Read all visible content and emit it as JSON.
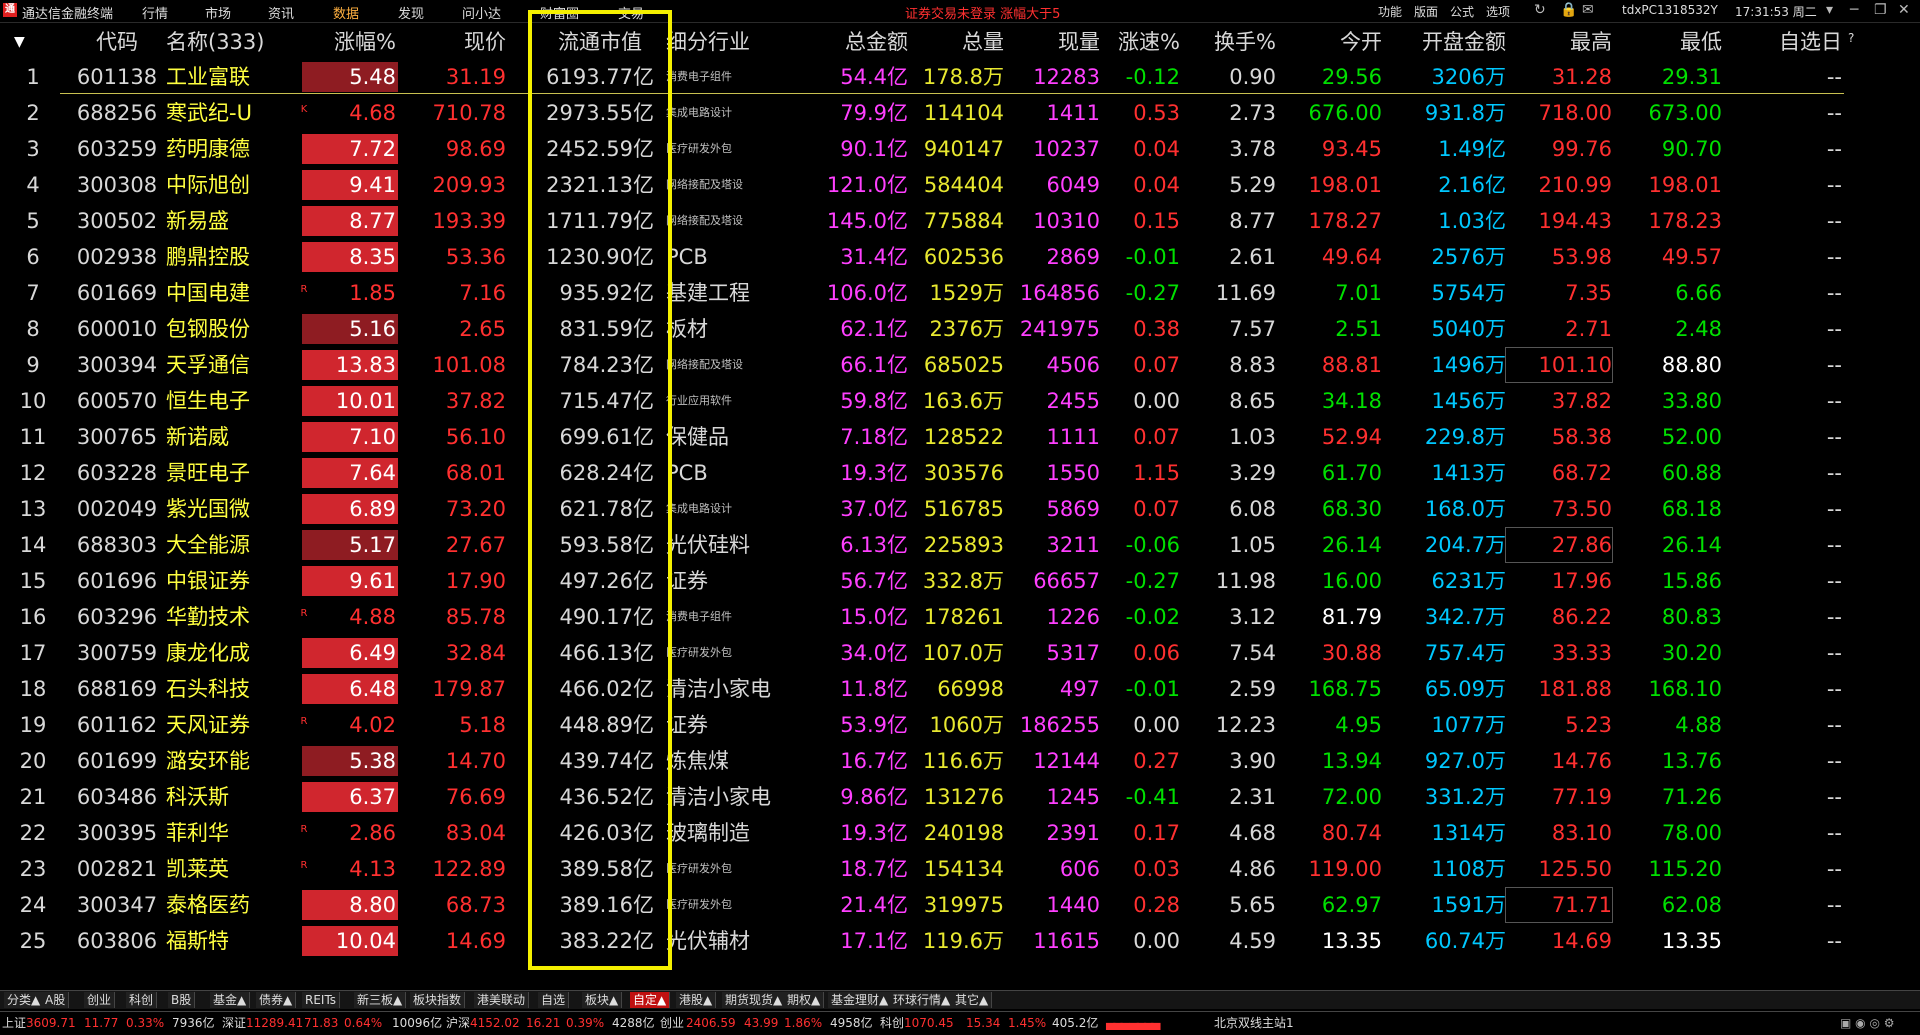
{
  "app": {
    "title": "通达信金融终端",
    "menus": [
      "行情",
      "市场",
      "资讯",
      "数据",
      "发现",
      "问小达",
      "财富圈",
      "交易"
    ],
    "active_menu": "数据",
    "notice": "证券交易未登录  涨幅大于5",
    "right_menus": [
      "功能",
      "版面",
      "公式",
      "选项"
    ],
    "user": "tdxPC1318532Y",
    "clock": "17:31:53 周二",
    "icons": [
      "refresh-icon",
      "lock-icon",
      "mail-icon",
      "minimize-icon",
      "restore-icon",
      "close-icon"
    ]
  },
  "table": {
    "sort_indicator": "▼",
    "headers": [
      "代码",
      "名称(333)",
      "涨幅%",
      "现价",
      "流通市值",
      "细分行业",
      "总金额",
      "总量",
      "现量",
      "涨速%",
      "换手%",
      "今开",
      "开盘金额",
      "最高",
      "最低",
      "自选日"
    ],
    "header_corner_mark": "?",
    "rows": [
      {
        "no": "1",
        "code": "601138",
        "name": "工业富联",
        "mark": "",
        "chg": "5.48",
        "price": "31.19",
        "mcap": "6193.77亿",
        "industry": "消费电子组件",
        "ind_small": true,
        "amount": "54.4亿",
        "vol": "178.8万",
        "lastvol": "12283",
        "speed": "-0.12",
        "turnover": "0.90",
        "open": "29.56",
        "open_amt": "3206万",
        "high": "31.28",
        "low": "29.31",
        "fav": "--"
      },
      {
        "no": "2",
        "code": "688256",
        "name": "寒武纪-U",
        "mark": "K",
        "chg": "4.68",
        "price": "710.78",
        "mcap": "2973.55亿",
        "industry": "集成电路设计",
        "ind_small": true,
        "amount": "79.9亿",
        "vol": "114104",
        "lastvol": "1411",
        "speed": "0.53",
        "turnover": "2.73",
        "open": "676.00",
        "open_amt": "931.8万",
        "high": "718.00",
        "low": "673.00",
        "fav": "--"
      },
      {
        "no": "3",
        "code": "603259",
        "name": "药明康德",
        "mark": "",
        "chg": "7.72",
        "price": "98.69",
        "mcap": "2452.59亿",
        "industry": "医疗研发外包",
        "ind_small": true,
        "amount": "90.1亿",
        "vol": "940147",
        "lastvol": "10237",
        "speed": "0.04",
        "turnover": "3.78",
        "open": "93.45",
        "open_amt": "1.49亿",
        "high": "99.76",
        "low": "90.70",
        "fav": "--"
      },
      {
        "no": "4",
        "code": "300308",
        "name": "中际旭创",
        "mark": "",
        "chg": "9.41",
        "price": "209.93",
        "mcap": "2321.13亿",
        "industry": "网络接配及塔设",
        "ind_small": true,
        "amount": "121.0亿",
        "vol": "584404",
        "lastvol": "6049",
        "speed": "0.04",
        "turnover": "5.29",
        "open": "198.01",
        "open_amt": "2.16亿",
        "high": "210.99",
        "low": "198.01",
        "fav": "--"
      },
      {
        "no": "5",
        "code": "300502",
        "name": "新易盛",
        "mark": "",
        "chg": "8.77",
        "price": "193.39",
        "mcap": "1711.79亿",
        "industry": "网络接配及塔设",
        "ind_small": true,
        "amount": "145.0亿",
        "vol": "775884",
        "lastvol": "10310",
        "speed": "0.15",
        "turnover": "8.77",
        "open": "178.27",
        "open_amt": "1.03亿",
        "high": "194.43",
        "low": "178.23",
        "fav": "--"
      },
      {
        "no": "6",
        "code": "002938",
        "name": "鹏鼎控股",
        "mark": "",
        "chg": "8.35",
        "price": "53.36",
        "mcap": "1230.90亿",
        "industry": "PCB",
        "ind_small": false,
        "amount": "31.4亿",
        "vol": "602536",
        "lastvol": "2869",
        "speed": "-0.01",
        "turnover": "2.61",
        "open": "49.64",
        "open_amt": "2576万",
        "high": "53.98",
        "low": "49.57",
        "fav": "--"
      },
      {
        "no": "7",
        "code": "601669",
        "name": "中国电建",
        "mark": "R",
        "chg": "1.85",
        "price": "7.16",
        "mcap": "935.92亿",
        "industry": "基建工程",
        "ind_small": false,
        "amount": "106.0亿",
        "vol": "1529万",
        "lastvol": "164856",
        "speed": "-0.27",
        "turnover": "11.69",
        "open": "7.01",
        "open_amt": "5754万",
        "high": "7.35",
        "low": "6.66",
        "fav": "--"
      },
      {
        "no": "8",
        "code": "600010",
        "name": "包钢股份",
        "mark": "",
        "chg": "5.16",
        "price": "2.65",
        "mcap": "831.59亿",
        "industry": "板材",
        "ind_small": false,
        "amount": "62.1亿",
        "vol": "2376万",
        "lastvol": "241975",
        "speed": "0.38",
        "turnover": "7.57",
        "open": "2.51",
        "open_amt": "5040万",
        "high": "2.71",
        "low": "2.48",
        "fav": "--"
      },
      {
        "no": "9",
        "code": "300394",
        "name": "天孚通信",
        "mark": "",
        "chg": "13.83",
        "price": "101.08",
        "mcap": "784.23亿",
        "industry": "网络接配及塔设",
        "ind_small": true,
        "amount": "66.1亿",
        "vol": "685025",
        "lastvol": "4506",
        "speed": "0.07",
        "turnover": "8.83",
        "open": "88.81",
        "open_amt": "1496万",
        "high": "101.10",
        "low": "88.80",
        "fav": "--"
      },
      {
        "no": "10",
        "code": "600570",
        "name": "恒生电子",
        "mark": "",
        "chg": "10.01",
        "price": "37.82",
        "mcap": "715.47亿",
        "industry": "行业应用软件",
        "ind_small": true,
        "amount": "59.8亿",
        "vol": "163.6万",
        "lastvol": "2455",
        "speed": "0.00",
        "turnover": "8.65",
        "open": "34.18",
        "open_amt": "1456万",
        "high": "37.82",
        "low": "33.80",
        "fav": "--"
      },
      {
        "no": "11",
        "code": "300765",
        "name": "新诺威",
        "mark": "",
        "chg": "7.10",
        "price": "56.10",
        "mcap": "699.61亿",
        "industry": "保健品",
        "ind_small": false,
        "amount": "7.18亿",
        "vol": "128522",
        "lastvol": "1111",
        "speed": "0.07",
        "turnover": "1.03",
        "open": "52.94",
        "open_amt": "229.8万",
        "high": "58.38",
        "low": "52.00",
        "fav": "--"
      },
      {
        "no": "12",
        "code": "603228",
        "name": "景旺电子",
        "mark": "",
        "chg": "7.64",
        "price": "68.01",
        "mcap": "628.24亿",
        "industry": "PCB",
        "ind_small": false,
        "amount": "19.3亿",
        "vol": "303576",
        "lastvol": "1550",
        "speed": "1.15",
        "turnover": "3.29",
        "open": "61.70",
        "open_amt": "1413万",
        "high": "68.72",
        "low": "60.88",
        "fav": "--"
      },
      {
        "no": "13",
        "code": "002049",
        "name": "紫光国微",
        "mark": "",
        "chg": "6.89",
        "price": "73.20",
        "mcap": "621.78亿",
        "industry": "集成电路设计",
        "ind_small": true,
        "amount": "37.0亿",
        "vol": "516785",
        "lastvol": "5869",
        "speed": "0.07",
        "turnover": "6.08",
        "open": "68.30",
        "open_amt": "168.0万",
        "high": "73.50",
        "low": "68.18",
        "fav": "--"
      },
      {
        "no": "14",
        "code": "688303",
        "name": "大全能源",
        "mark": "",
        "chg": "5.17",
        "price": "27.67",
        "mcap": "593.58亿",
        "industry": "光伏硅料",
        "ind_small": false,
        "amount": "6.13亿",
        "vol": "225893",
        "lastvol": "3211",
        "speed": "-0.06",
        "turnover": "1.05",
        "open": "26.14",
        "open_amt": "204.7万",
        "high": "27.86",
        "low": "26.14",
        "fav": "--"
      },
      {
        "no": "15",
        "code": "601696",
        "name": "中银证券",
        "mark": "",
        "chg": "9.61",
        "price": "17.90",
        "mcap": "497.26亿",
        "industry": "证券",
        "ind_small": false,
        "amount": "56.7亿",
        "vol": "332.8万",
        "lastvol": "66657",
        "speed": "-0.27",
        "turnover": "11.98",
        "open": "16.00",
        "open_amt": "6231万",
        "high": "17.96",
        "low": "15.86",
        "fav": "--"
      },
      {
        "no": "16",
        "code": "603296",
        "name": "华勤技术",
        "mark": "R",
        "chg": "4.88",
        "price": "85.78",
        "mcap": "490.17亿",
        "industry": "消费电子组件",
        "ind_small": true,
        "amount": "15.0亿",
        "vol": "178261",
        "lastvol": "1226",
        "speed": "-0.02",
        "turnover": "3.12",
        "open": "81.79",
        "open_amt": "342.7万",
        "high": "86.22",
        "low": "80.83",
        "fav": "--"
      },
      {
        "no": "17",
        "code": "300759",
        "name": "康龙化成",
        "mark": "",
        "chg": "6.49",
        "price": "32.84",
        "mcap": "466.13亿",
        "industry": "医疗研发外包",
        "ind_small": true,
        "amount": "34.0亿",
        "vol": "107.0万",
        "lastvol": "5317",
        "speed": "0.06",
        "turnover": "7.54",
        "open": "30.88",
        "open_amt": "757.4万",
        "high": "33.33",
        "low": "30.20",
        "fav": "--"
      },
      {
        "no": "18",
        "code": "688169",
        "name": "石头科技",
        "mark": "",
        "chg": "6.48",
        "price": "179.87",
        "mcap": "466.02亿",
        "industry": "清洁小家电",
        "ind_small": false,
        "amount": "11.8亿",
        "vol": "66998",
        "lastvol": "497",
        "speed": "-0.01",
        "turnover": "2.59",
        "open": "168.75",
        "open_amt": "65.09万",
        "high": "181.88",
        "low": "168.10",
        "fav": "--"
      },
      {
        "no": "19",
        "code": "601162",
        "name": "天风证券",
        "mark": "R",
        "chg": "4.02",
        "price": "5.18",
        "mcap": "448.89亿",
        "industry": "证券",
        "ind_small": false,
        "amount": "53.9亿",
        "vol": "1060万",
        "lastvol": "186255",
        "speed": "0.00",
        "turnover": "12.23",
        "open": "4.95",
        "open_amt": "1077万",
        "high": "5.23",
        "low": "4.88",
        "fav": "--"
      },
      {
        "no": "20",
        "code": "601699",
        "name": "潞安环能",
        "mark": "",
        "chg": "5.38",
        "price": "14.70",
        "mcap": "439.74亿",
        "industry": "炼焦煤",
        "ind_small": false,
        "amount": "16.7亿",
        "vol": "116.6万",
        "lastvol": "12144",
        "speed": "0.27",
        "turnover": "3.90",
        "open": "13.94",
        "open_amt": "927.0万",
        "high": "14.76",
        "low": "13.76",
        "fav": "--"
      },
      {
        "no": "21",
        "code": "603486",
        "name": "科沃斯",
        "mark": "",
        "chg": "6.37",
        "price": "76.69",
        "mcap": "436.52亿",
        "industry": "清洁小家电",
        "ind_small": false,
        "amount": "9.86亿",
        "vol": "131276",
        "lastvol": "1245",
        "speed": "-0.41",
        "turnover": "2.31",
        "open": "72.00",
        "open_amt": "331.2万",
        "high": "77.19",
        "low": "71.26",
        "fav": "--"
      },
      {
        "no": "22",
        "code": "300395",
        "name": "菲利华",
        "mark": "R",
        "chg": "2.86",
        "price": "83.04",
        "mcap": "426.03亿",
        "industry": "玻璃制造",
        "ind_small": false,
        "amount": "19.3亿",
        "vol": "240198",
        "lastvol": "2391",
        "speed": "0.17",
        "turnover": "4.68",
        "open": "80.74",
        "open_amt": "1314万",
        "high": "83.10",
        "low": "78.00",
        "fav": "--"
      },
      {
        "no": "23",
        "code": "002821",
        "name": "凯莱英",
        "mark": "R",
        "chg": "4.13",
        "price": "122.89",
        "mcap": "389.58亿",
        "industry": "医疗研发外包",
        "ind_small": true,
        "amount": "18.7亿",
        "vol": "154134",
        "lastvol": "606",
        "speed": "0.03",
        "turnover": "4.86",
        "open": "119.00",
        "open_amt": "1108万",
        "high": "125.50",
        "low": "115.20",
        "fav": "--"
      },
      {
        "no": "24",
        "code": "300347",
        "name": "泰格医药",
        "mark": "",
        "chg": "8.80",
        "price": "68.73",
        "mcap": "389.16亿",
        "industry": "医疗研发外包",
        "ind_small": true,
        "amount": "21.4亿",
        "vol": "319975",
        "lastvol": "1440",
        "speed": "0.28",
        "turnover": "5.65",
        "open": "62.97",
        "open_amt": "1591万",
        "high": "71.71",
        "low": "62.08",
        "fav": "--"
      },
      {
        "no": "25",
        "code": "603806",
        "name": "福斯特",
        "mark": "",
        "chg": "10.04",
        "price": "14.69",
        "mcap": "383.22亿",
        "industry": "光伏辅材",
        "ind_small": false,
        "amount": "17.1亿",
        "vol": "119.6万",
        "lastvol": "11615",
        "speed": "0.00",
        "turnover": "4.59",
        "open": "13.35",
        "open_amt": "60.74万",
        "high": "14.69",
        "low": "13.35",
        "fav": "--"
      }
    ]
  },
  "tabs": [
    "分类▲",
    "A股",
    "创业",
    "科创",
    "B股",
    "基金▲",
    "债券▲",
    "REITs",
    "新三板▲",
    "板块指数",
    "港美联动",
    "自选",
    "板块▲",
    "自定▲",
    "港股▲",
    "期货现货▲",
    "期权▲",
    "基金理财▲",
    "环球行情▲",
    "其它▲"
  ],
  "active_tab": "自定▲",
  "status": {
    "sh": {
      "label": "上证",
      "value": "3609.71",
      "chg": "11.77",
      "pct": "0.33%",
      "amt": "7936亿"
    },
    "sz": {
      "label": "深证",
      "value": "11289.41",
      "chg": "71.83",
      "pct": "0.64%",
      "amt": "10096亿"
    },
    "hs": {
      "label": "沪深",
      "value": "4152.02",
      "chg": "16.21",
      "pct": "0.39%",
      "amt": "4288亿"
    },
    "cy": {
      "label": "创业",
      "value": "2406.59",
      "chg": "43.99",
      "pct": "1.86%",
      "amt": "4958亿"
    },
    "kc": {
      "label": "科创",
      "value": "1070.45",
      "chg": "15.34",
      "pct": "1.45%",
      "amt": "405.2亿"
    },
    "server": "北京双线主站1"
  },
  "colors": {
    "up": "#ff3030",
    "down": "#00e000",
    "amount": "#ff40ff",
    "volume": "#e8e830",
    "cyan": "#00c8ff",
    "white": "#ffffff",
    "highlight": "#f5f000"
  }
}
